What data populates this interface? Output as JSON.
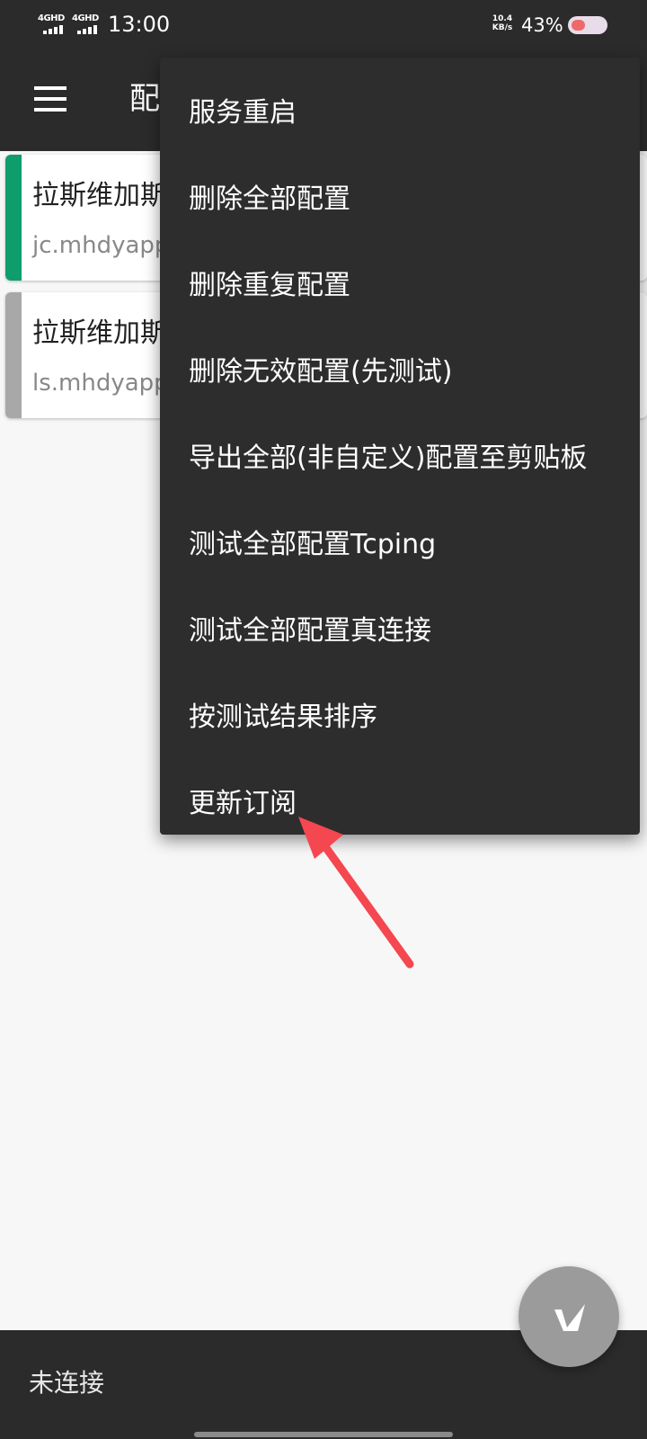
{
  "status_bar": {
    "sim1": "4GHD",
    "sim2": "4GHD",
    "time": "13:00",
    "speed_value": "10.4",
    "speed_unit": "KB/s",
    "battery_percent": "43%",
    "battery_level": 0.43
  },
  "app_bar": {
    "title": "配"
  },
  "servers": [
    {
      "name": "拉斯维加斯",
      "address": "jc.mhdyapp",
      "accent_color": "#0f9d6b"
    },
    {
      "name": "拉斯维加斯",
      "address": "ls.mhdyapp",
      "accent_color": "#a8a8a8"
    }
  ],
  "overflow_menu": {
    "items": [
      "服务重启",
      "删除全部配置",
      "删除重复配置",
      "删除无效配置(先测试)",
      "导出全部(非自定义)配置至剪贴板",
      "测试全部配置Tcping",
      "测试全部配置真连接",
      "按测试结果排序",
      "更新订阅"
    ]
  },
  "annotation": {
    "arrow_color": "#f4474f",
    "target": "更新订阅"
  },
  "bottom_bar": {
    "connection_status": "未连接"
  },
  "fab": {
    "icon": "v-logo-icon"
  },
  "colors": {
    "bar_background": "#2b2b2b",
    "menu_background": "#2d2d2d",
    "page_background": "#f7f7f7",
    "fab_background": "#9b9b9b"
  }
}
